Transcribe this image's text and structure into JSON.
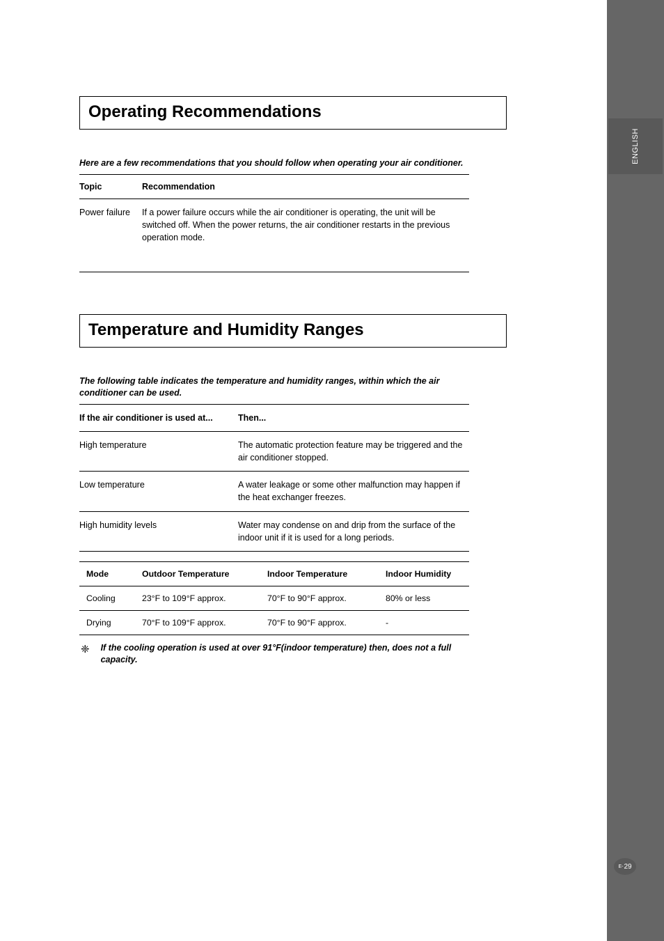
{
  "sidebar": {
    "tab_label": "ENGLISH"
  },
  "page": {
    "prefix": "E-",
    "number": "29"
  },
  "section1": {
    "heading": "Operating Recommendations",
    "intro": "Here are a few recommendations that you should follow when operating your air conditioner.",
    "headers": {
      "topic": "Topic",
      "recommendation": "Recommendation"
    },
    "rows": [
      {
        "topic": "Power failure",
        "recommendation": "If a power failure occurs while the air conditioner is operating, the unit will be switched off. When the power returns, the air conditioner restarts in the previous operation mode."
      }
    ]
  },
  "section2": {
    "heading": "Temperature and Humidity Ranges",
    "intro": "The following table indicates the temperature and humidity ranges, within which the air conditioner can be used.",
    "headers": {
      "condition": "If the air conditioner is used at...",
      "then": "Then..."
    },
    "rows": [
      {
        "condition": "High temperature",
        "then": "The automatic protection feature may be triggered and the air conditioner stopped."
      },
      {
        "condition": "Low temperature",
        "then": "A water leakage or some other malfunction may happen if the heat exchanger freezes."
      },
      {
        "condition": "High humidity levels",
        "then": "Water may condense on and drip from the surface of the indoor unit if it is used for a long periods."
      }
    ],
    "modes": {
      "headers": {
        "mode": "Mode",
        "outdoor": "Outdoor Temperature",
        "indoor": "Indoor Temperature",
        "humidity": "Indoor Humidity"
      },
      "rows": [
        {
          "mode": "Cooling",
          "outdoor": "23°F to 109°F approx.",
          "indoor": "70°F to 90°F approx.",
          "humidity": "80% or less"
        },
        {
          "mode": "Drying",
          "outdoor": "70°F to 109°F approx.",
          "indoor": "70°F to 90°F approx.",
          "humidity": "-"
        }
      ]
    },
    "footnote": {
      "symbol": "❈",
      "text": "If the cooling operation is used at over 91°F(indoor temperature) then, does not a full capacity."
    }
  }
}
